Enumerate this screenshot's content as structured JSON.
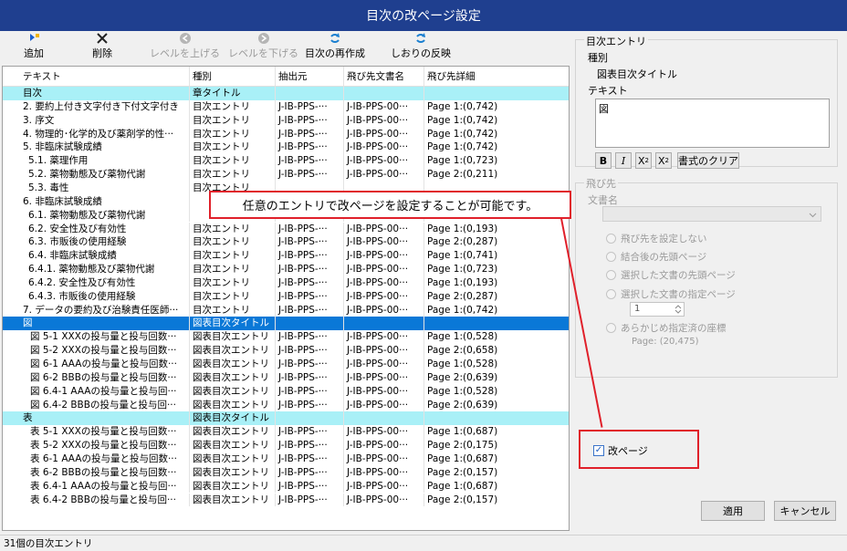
{
  "window": {
    "title": "目次の改ページ設定"
  },
  "toolbar": {
    "add": "追加",
    "delete": "削除",
    "level_up": "レベルを上げる",
    "level_down": "レベルを下げる",
    "recreate": "目次の再作成",
    "bookmark_reflect": "しおりの反映"
  },
  "table": {
    "headers": [
      "テキスト",
      "種別",
      "抽出元",
      "飛び先文書名",
      "飛び先詳細"
    ],
    "rows": [
      [
        "目次",
        "章タイトル",
        "",
        "",
        ""
      ],
      [
        "2. 要約上付き文字付き下付文字付き",
        "目次エントリ",
        "J-IB-PPS-···",
        "J-IB-PPS-00···",
        "Page 1:(0,742)"
      ],
      [
        "3. 序文",
        "目次エントリ",
        "J-IB-PPS-···",
        "J-IB-PPS-00···",
        "Page 1:(0,742)"
      ],
      [
        "4. 物理的･化学的及び薬剤学的性···",
        "目次エントリ",
        "J-IB-PPS-···",
        "J-IB-PPS-00···",
        "Page 1:(0,742)"
      ],
      [
        "5. 非臨床試験成績",
        "目次エントリ",
        "J-IB-PPS-···",
        "J-IB-PPS-00···",
        "Page 1:(0,742)"
      ],
      [
        "5.1. 薬理作用",
        "目次エントリ",
        "J-IB-PPS-···",
        "J-IB-PPS-00···",
        "Page 1:(0,723)"
      ],
      [
        "5.2. 薬物動態及び薬物代謝",
        "目次エントリ",
        "J-IB-PPS-···",
        "J-IB-PPS-00···",
        "Page 2:(0,211)"
      ],
      [
        "5.3. 毒性",
        "目次エントリ",
        "",
        "",
        ""
      ],
      [
        "6. 非臨床試験成績",
        "",
        "",
        "",
        ""
      ],
      [
        "6.1. 薬物動態及び薬物代謝",
        "",
        "",
        "",
        ""
      ],
      [
        "6.2. 安全性及び有効性",
        "目次エントリ",
        "J-IB-PPS-···",
        "J-IB-PPS-00···",
        "Page 1:(0,193)"
      ],
      [
        "6.3. 市販後の使用経験",
        "目次エントリ",
        "J-IB-PPS-···",
        "J-IB-PPS-00···",
        "Page 2:(0,287)"
      ],
      [
        "6.4. 非臨床試験成績",
        "目次エントリ",
        "J-IB-PPS-···",
        "J-IB-PPS-00···",
        "Page 1:(0,741)"
      ],
      [
        "6.4.1. 薬物動態及び薬物代謝",
        "目次エントリ",
        "J-IB-PPS-···",
        "J-IB-PPS-00···",
        "Page 1:(0,723)"
      ],
      [
        "6.4.2. 安全性及び有効性",
        "目次エントリ",
        "J-IB-PPS-···",
        "J-IB-PPS-00···",
        "Page 1:(0,193)"
      ],
      [
        "6.4.3. 市販後の使用経験",
        "目次エントリ",
        "J-IB-PPS-···",
        "J-IB-PPS-00···",
        "Page 2:(0,287)"
      ],
      [
        "7. データの要約及び治験責任医師···",
        "目次エントリ",
        "J-IB-PPS-···",
        "J-IB-PPS-00···",
        "Page 1:(0,742)"
      ],
      [
        "図",
        "図表目次タイトル",
        "",
        "",
        ""
      ],
      [
        "図 5-1 XXXの投与量と投与回数···",
        "図表目次エントリ",
        "J-IB-PPS-···",
        "J-IB-PPS-00···",
        "Page 1:(0,528)"
      ],
      [
        "図 5-2 XXXの投与量と投与回数···",
        "図表目次エントリ",
        "J-IB-PPS-···",
        "J-IB-PPS-00···",
        "Page 2:(0,658)"
      ],
      [
        "図 6-1 AAAの投与量と投与回数···",
        "図表目次エントリ",
        "J-IB-PPS-···",
        "J-IB-PPS-00···",
        "Page 1:(0,528)"
      ],
      [
        "図 6-2 BBBの投与量と投与回数···",
        "図表目次エントリ",
        "J-IB-PPS-···",
        "J-IB-PPS-00···",
        "Page 2:(0,639)"
      ],
      [
        "図 6.4-1 AAAの投与量と投与回···",
        "図表目次エントリ",
        "J-IB-PPS-···",
        "J-IB-PPS-00···",
        "Page 1:(0,528)"
      ],
      [
        "図 6.4-2 BBBの投与量と投与回···",
        "図表目次エントリ",
        "J-IB-PPS-···",
        "J-IB-PPS-00···",
        "Page 2:(0,639)"
      ],
      [
        "表",
        "図表目次タイトル",
        "",
        "",
        ""
      ],
      [
        "表 5-1 XXXの投与量と投与回数···",
        "図表目次エントリ",
        "J-IB-PPS-···",
        "J-IB-PPS-00···",
        "Page 1:(0,687)"
      ],
      [
        "表 5-2 XXXの投与量と投与回数···",
        "図表目次エントリ",
        "J-IB-PPS-···",
        "J-IB-PPS-00···",
        "Page 2:(0,175)"
      ],
      [
        "表 6-1 AAAの投与量と投与回数···",
        "図表目次エントリ",
        "J-IB-PPS-···",
        "J-IB-PPS-00···",
        "Page 1:(0,687)"
      ],
      [
        "表 6-2 BBBの投与量と投与回数···",
        "図表目次エントリ",
        "J-IB-PPS-···",
        "J-IB-PPS-00···",
        "Page 2:(0,157)"
      ],
      [
        "表 6.4-1 AAAの投与量と投与回···",
        "図表目次エントリ",
        "J-IB-PPS-···",
        "J-IB-PPS-00···",
        "Page 1:(0,687)"
      ],
      [
        "表 6.4-2 BBBの投与量と投与回···",
        "図表目次エントリ",
        "J-IB-PPS-···",
        "J-IB-PPS-00···",
        "Page 2:(0,157)"
      ]
    ],
    "cyan_rows": [
      0,
      17,
      24
    ],
    "selected_row": 17
  },
  "status": {
    "text": "31個の目次エントリ"
  },
  "entry_panel": {
    "title": "目次エントリ",
    "type_label": "種別",
    "type_value": "図表目次タイトル",
    "text_label": "テキスト",
    "text_value": "図",
    "bold": "B",
    "italic": "I",
    "subscript": "X",
    "subscript_mark": "2",
    "superscript": "X",
    "superscript_mark": "2",
    "clear_format": "書式のクリア"
  },
  "jump_panel": {
    "title": "飛び先",
    "doc_label": "文書名",
    "options": [
      "飛び先を設定しない",
      "結合後の先頭ページ",
      "選択した文書の先頭ページ",
      "選択した文書の指定ページ",
      "あらかじめ指定済の座標"
    ],
    "page_number": "1",
    "coord_text": "Page: (20,475)"
  },
  "page_break": {
    "label": "改ページ",
    "checked": true
  },
  "buttons": {
    "apply": "適用",
    "cancel": "キャンセル"
  },
  "callout": {
    "text": "任意のエントリで改ページを設定することが可能です。"
  },
  "colors": {
    "titlebar": "#1f3f8f",
    "selection": "#0a78d7",
    "cyan_row": "#a9f0f7",
    "highlight_red": "#e0202a"
  }
}
